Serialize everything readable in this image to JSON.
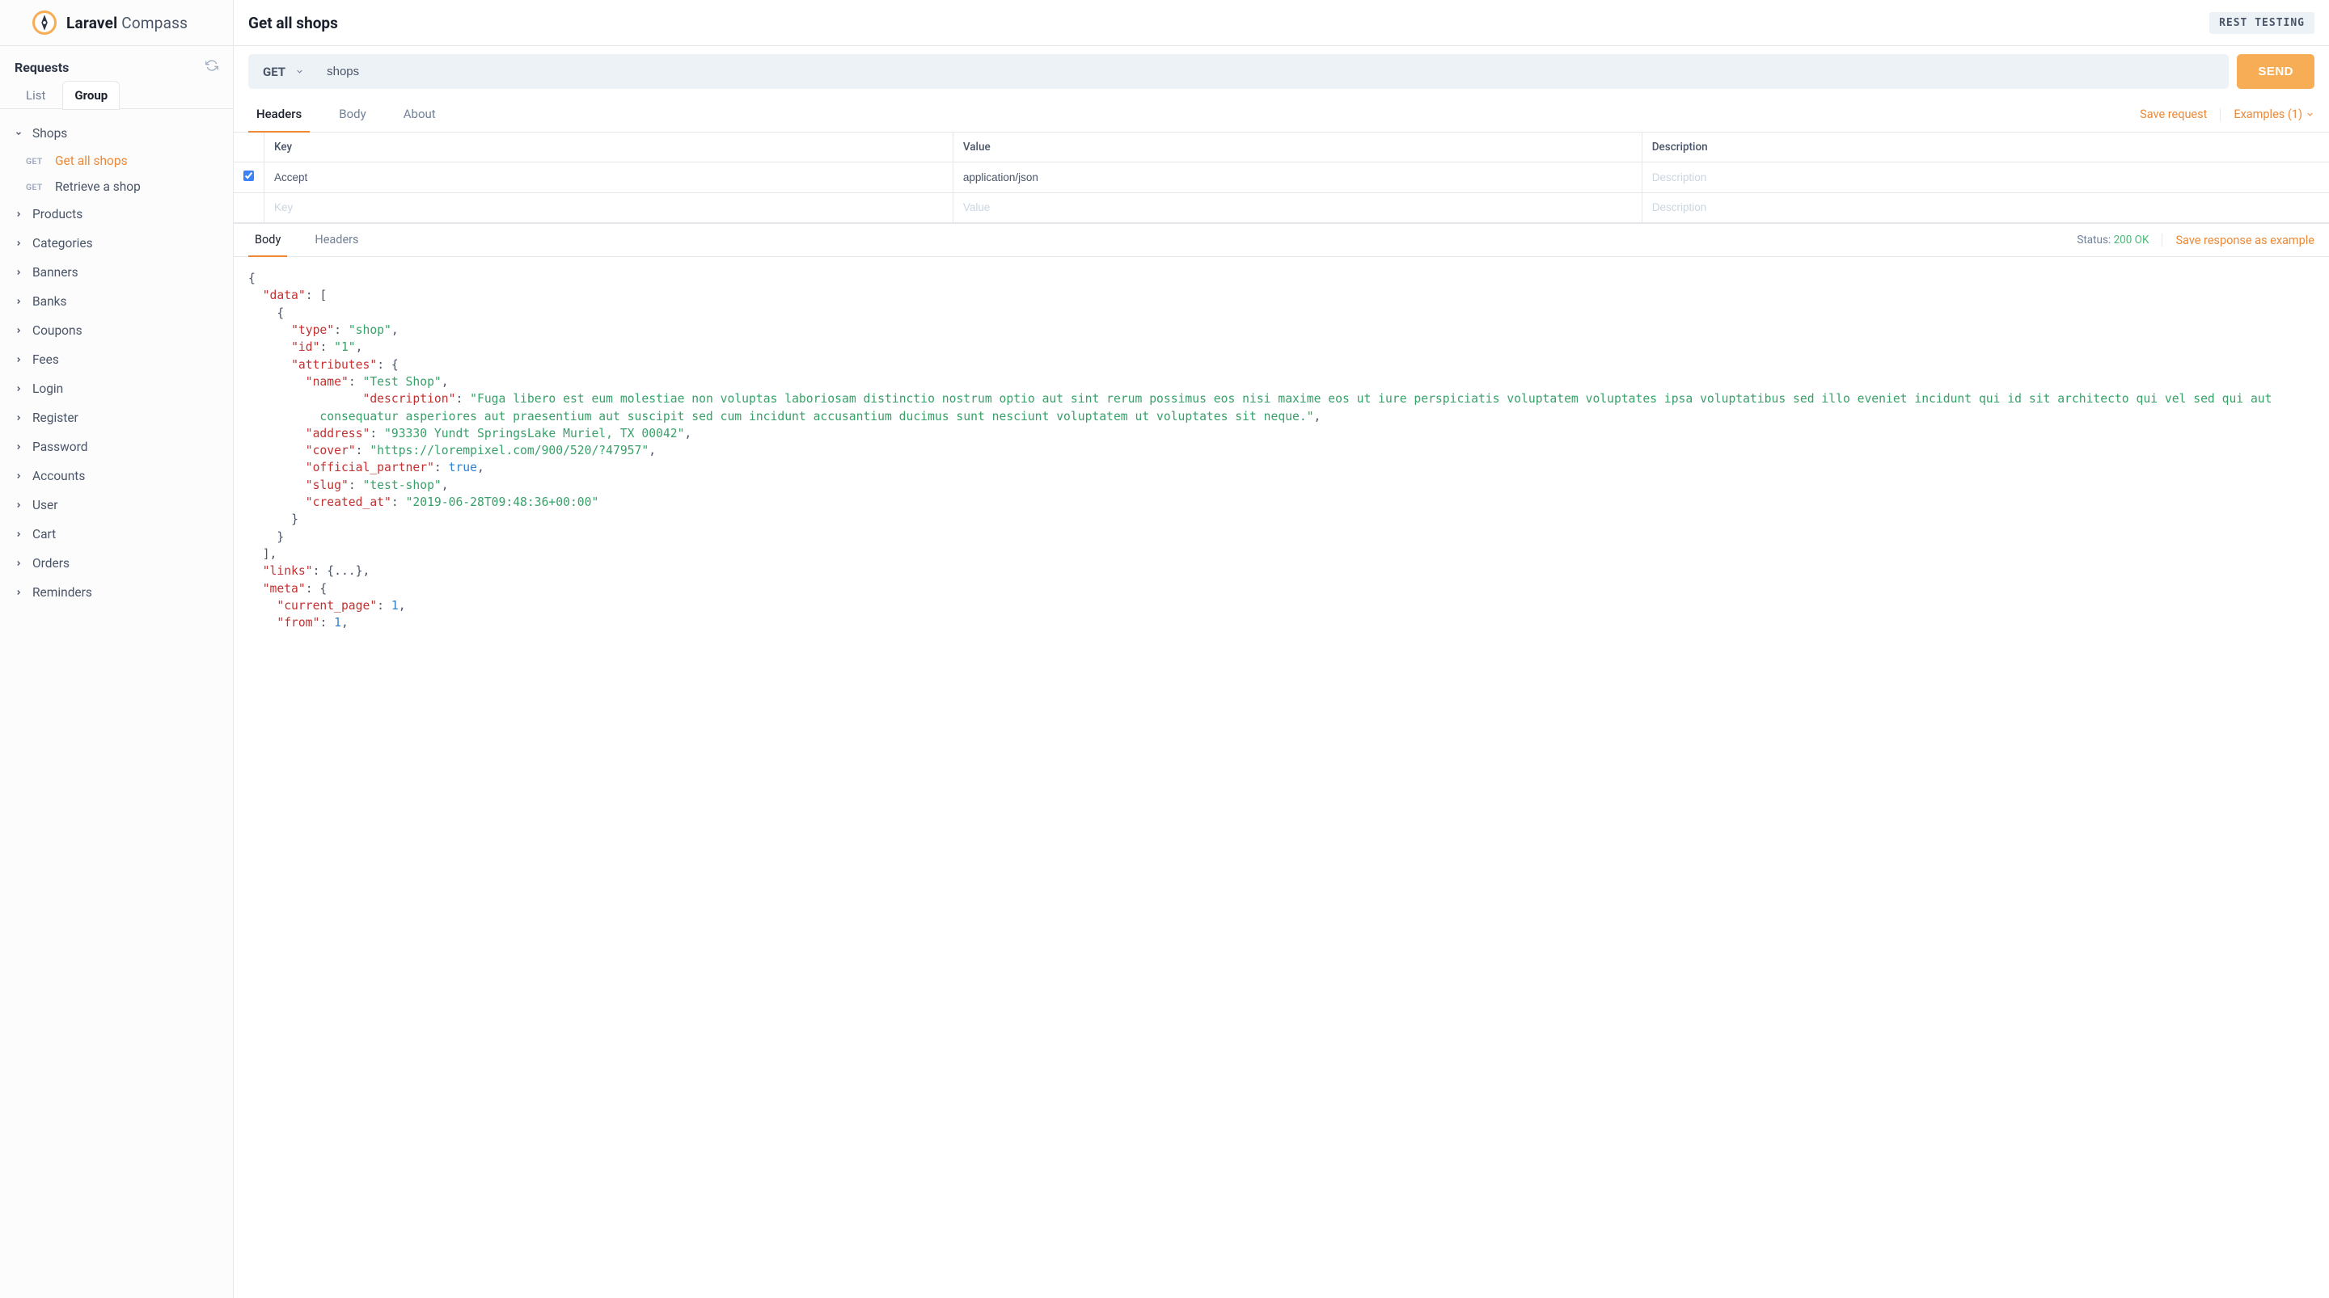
{
  "brand": {
    "strong": "Laravel",
    "light": "Compass"
  },
  "sidebar": {
    "requests_label": "Requests",
    "view_tabs": {
      "list": "List",
      "group": "Group"
    },
    "groups": [
      {
        "label": "Shops",
        "expanded": true,
        "items": [
          {
            "method": "GET",
            "label": "Get all shops",
            "active": true
          },
          {
            "method": "GET",
            "label": "Retrieve a shop"
          }
        ]
      },
      {
        "label": "Products"
      },
      {
        "label": "Categories"
      },
      {
        "label": "Banners"
      },
      {
        "label": "Banks"
      },
      {
        "label": "Coupons"
      },
      {
        "label": "Fees"
      },
      {
        "label": "Login"
      },
      {
        "label": "Register"
      },
      {
        "label": "Password"
      },
      {
        "label": "Accounts"
      },
      {
        "label": "User"
      },
      {
        "label": "Cart"
      },
      {
        "label": "Orders"
      },
      {
        "label": "Reminders"
      }
    ]
  },
  "topbar": {
    "title": "Get all shops",
    "env": "REST TESTING"
  },
  "request": {
    "method": "GET",
    "url": "shops",
    "send_label": "SEND",
    "tabs": {
      "headers": "Headers",
      "body": "Body",
      "about": "About"
    },
    "actions": {
      "save": "Save request",
      "examples": "Examples (1)"
    },
    "header_columns": {
      "key": "Key",
      "value": "Value",
      "desc": "Description"
    },
    "header_rows": [
      {
        "checked": true,
        "key": "Accept",
        "value": "application/json",
        "desc": ""
      }
    ],
    "placeholder": {
      "key": "Key",
      "value": "Value",
      "desc": "Description"
    }
  },
  "response": {
    "tabs": {
      "body": "Body",
      "headers": "Headers"
    },
    "status_label": "Status:",
    "status_value": "200 OK",
    "save_label": "Save response as example",
    "body_lines": [
      {
        "i": 0,
        "t": [
          {
            "c": "p",
            "v": "{"
          }
        ]
      },
      {
        "i": 1,
        "t": [
          {
            "c": "k",
            "v": "\"data\""
          },
          {
            "c": "p",
            "v": ": ["
          }
        ]
      },
      {
        "i": 2,
        "t": [
          {
            "c": "p",
            "v": "{"
          }
        ]
      },
      {
        "i": 3,
        "t": [
          {
            "c": "k",
            "v": "\"type\""
          },
          {
            "c": "p",
            "v": ": "
          },
          {
            "c": "s",
            "v": "\"shop\""
          },
          {
            "c": "p",
            "v": ","
          }
        ]
      },
      {
        "i": 3,
        "t": [
          {
            "c": "k",
            "v": "\"id\""
          },
          {
            "c": "p",
            "v": ": "
          },
          {
            "c": "s",
            "v": "\"1\""
          },
          {
            "c": "p",
            "v": ","
          }
        ]
      },
      {
        "i": 3,
        "t": [
          {
            "c": "k",
            "v": "\"attributes\""
          },
          {
            "c": "p",
            "v": ": {"
          }
        ]
      },
      {
        "i": 4,
        "t": [
          {
            "c": "k",
            "v": "\"name\""
          },
          {
            "c": "p",
            "v": ": "
          },
          {
            "c": "s",
            "v": "\"Test Shop\""
          },
          {
            "c": "p",
            "v": ","
          }
        ]
      },
      {
        "i": 4,
        "wrap": true,
        "t": [
          {
            "c": "k",
            "v": "\"description\""
          },
          {
            "c": "p",
            "v": ": "
          },
          {
            "c": "s",
            "v": "\"Fuga libero est eum molestiae non voluptas laboriosam distinctio nostrum optio aut sint rerum possimus eos nisi maxime eos ut iure perspiciatis voluptatem voluptates ipsa voluptatibus sed illo eveniet incidunt qui id sit architecto qui vel sed qui aut consequatur asperiores aut praesentium aut suscipit sed cum incidunt accusantium ducimus sunt nesciunt voluptatem ut voluptates sit neque.\""
          },
          {
            "c": "p",
            "v": ","
          }
        ]
      },
      {
        "i": 4,
        "t": [
          {
            "c": "k",
            "v": "\"address\""
          },
          {
            "c": "p",
            "v": ": "
          },
          {
            "c": "s",
            "v": "\"93330 Yundt SpringsLake Muriel, TX 00042\""
          },
          {
            "c": "p",
            "v": ","
          }
        ]
      },
      {
        "i": 4,
        "t": [
          {
            "c": "k",
            "v": "\"cover\""
          },
          {
            "c": "p",
            "v": ": "
          },
          {
            "c": "s",
            "v": "\"https://lorempixel.com/900/520/?47957\""
          },
          {
            "c": "p",
            "v": ","
          }
        ]
      },
      {
        "i": 4,
        "t": [
          {
            "c": "k",
            "v": "\"official_partner\""
          },
          {
            "c": "p",
            "v": ": "
          },
          {
            "c": "b",
            "v": "true"
          },
          {
            "c": "p",
            "v": ","
          }
        ]
      },
      {
        "i": 4,
        "t": [
          {
            "c": "k",
            "v": "\"slug\""
          },
          {
            "c": "p",
            "v": ": "
          },
          {
            "c": "s",
            "v": "\"test-shop\""
          },
          {
            "c": "p",
            "v": ","
          }
        ]
      },
      {
        "i": 4,
        "t": [
          {
            "c": "k",
            "v": "\"created_at\""
          },
          {
            "c": "p",
            "v": ": "
          },
          {
            "c": "s",
            "v": "\"2019-06-28T09:48:36+00:00\""
          }
        ]
      },
      {
        "i": 3,
        "t": [
          {
            "c": "p",
            "v": "}"
          }
        ]
      },
      {
        "i": 2,
        "t": [
          {
            "c": "p",
            "v": "}"
          }
        ]
      },
      {
        "i": 1,
        "t": [
          {
            "c": "p",
            "v": "],"
          }
        ]
      },
      {
        "i": 1,
        "t": [
          {
            "c": "k",
            "v": "\"links\""
          },
          {
            "c": "p",
            "v": ": {...},"
          }
        ]
      },
      {
        "i": 1,
        "t": [
          {
            "c": "k",
            "v": "\"meta\""
          },
          {
            "c": "p",
            "v": ": {"
          }
        ]
      },
      {
        "i": 2,
        "t": [
          {
            "c": "k",
            "v": "\"current_page\""
          },
          {
            "c": "p",
            "v": ": "
          },
          {
            "c": "n",
            "v": "1"
          },
          {
            "c": "p",
            "v": ","
          }
        ]
      },
      {
        "i": 2,
        "t": [
          {
            "c": "k",
            "v": "\"from\""
          },
          {
            "c": "p",
            "v": ": "
          },
          {
            "c": "n",
            "v": "1"
          },
          {
            "c": "p",
            "v": ","
          }
        ]
      }
    ]
  }
}
